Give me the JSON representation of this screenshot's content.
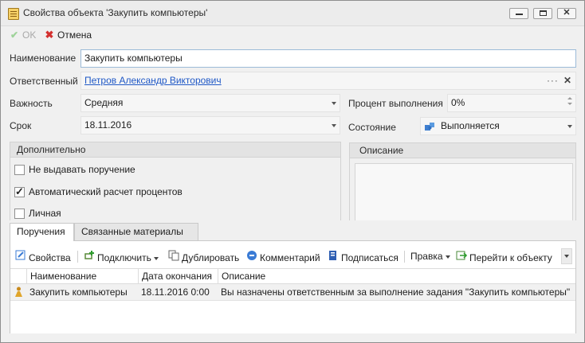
{
  "window": {
    "title": "Свойства объекта 'Закупить компьютеры'",
    "min_icon": "minimize-icon",
    "max_icon": "maximize-icon",
    "close_icon": "close-icon"
  },
  "actions": {
    "ok_label": "OK",
    "ok_icon": "checkmark-icon",
    "cancel_label": "Отмена",
    "cancel_icon": "cross-icon"
  },
  "form": {
    "name_label": "Наименование",
    "name_value": "Закупить компьютеры",
    "responsible_label": "Ответственный",
    "responsible_value": "Петров Александр Викторович",
    "responsible_more": "···",
    "responsible_clear": "✕",
    "importance_label": "Важность",
    "importance_value": "Средняя",
    "deadline_label": "Срок",
    "deadline_value": "18.11.2016",
    "percent_label": "Процент выполнения",
    "percent_value": "0%",
    "state_label": "Состояние",
    "state_value": "Выполняется",
    "state_icon": "puzzle-icon"
  },
  "additional": {
    "title": "Дополнительно",
    "options": [
      {
        "label": "Не выдавать поручение",
        "checked": false
      },
      {
        "label": "Автоматический расчет процентов",
        "checked": true
      },
      {
        "label": "Личная",
        "checked": false
      }
    ]
  },
  "description": {
    "title": "Описание",
    "text": ""
  },
  "tabs": [
    {
      "label": "Поручения",
      "active": true
    },
    {
      "label": "Связанные материалы",
      "active": false
    }
  ],
  "toolbar": {
    "properties": "Свойства",
    "connect": "Подключить",
    "duplicate": "Дублировать",
    "comment": "Комментарий",
    "sign": "Подписаться",
    "edit": "Правка",
    "goto": "Перейти к объекту"
  },
  "grid": {
    "columns": [
      "Наименование",
      "Дата окончания",
      "Описание"
    ],
    "rows": [
      {
        "name": "Закупить компьютеры",
        "end_date": "18.11.2016 0:00",
        "description": "Вы назначены ответственным за выполнение задания \"Закупить компьютеры\""
      }
    ]
  },
  "colors": {
    "link": "#1f58c6",
    "cancel_icon": "#d3302f",
    "ok_disabled": "#a9a9a9"
  }
}
